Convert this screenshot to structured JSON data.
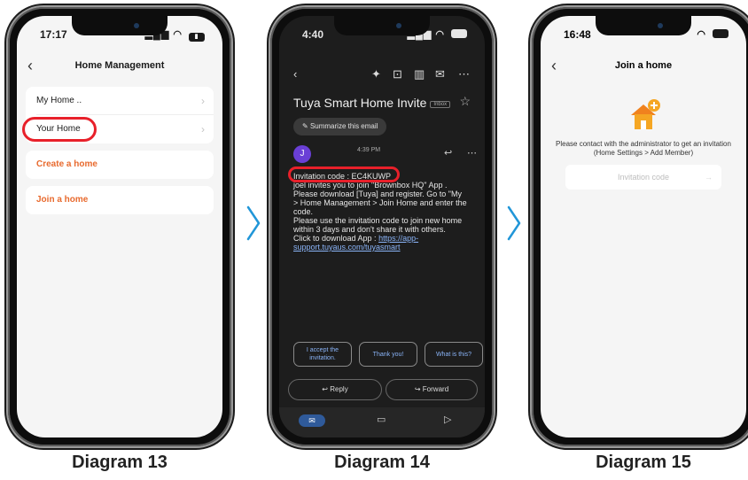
{
  "captions": [
    "Diagram 13",
    "Diagram 14",
    "Diagram 15"
  ],
  "accent": "#e86a2e",
  "highlight_color": "#e8202a",
  "screen13": {
    "time": "17:17",
    "title": "Home Management",
    "homes": [
      "My Home ..",
      "Your Home"
    ],
    "create": "Create a home",
    "join": "Join a home"
  },
  "screen14": {
    "time": "4:40",
    "subject": "Tuya Smart Home Invite",
    "inbox_label": "Inbox",
    "summarize": "Summarize this email",
    "sender_initial": "J",
    "sent_time": "4:39 PM",
    "code_line": "Invitation code : EC4KUWP",
    "body_lines": [
      "joel invites you to join \"Brownbox HQ\" App .",
      "Please download [Tuya] and register. Go to \"My",
      "> Home Management > Join Home and enter the",
      "code.",
      "Please use the invitation code to join new home",
      "within 3 days and don't share it with others.",
      "Click to download App  : "
    ],
    "link_part1": "https://app-",
    "link_part2": "support.tuyaus.com/tuyasmart",
    "chips": [
      "I accept the invitation.",
      "Thank you!",
      "What is this?"
    ],
    "reply": "Reply",
    "forward": "Forward"
  },
  "screen15": {
    "time": "16:48",
    "title": "Join a home",
    "message": "Please contact with the administrator to get an invitation (Home Settings > Add Member)",
    "placeholder": "Invitation code"
  }
}
